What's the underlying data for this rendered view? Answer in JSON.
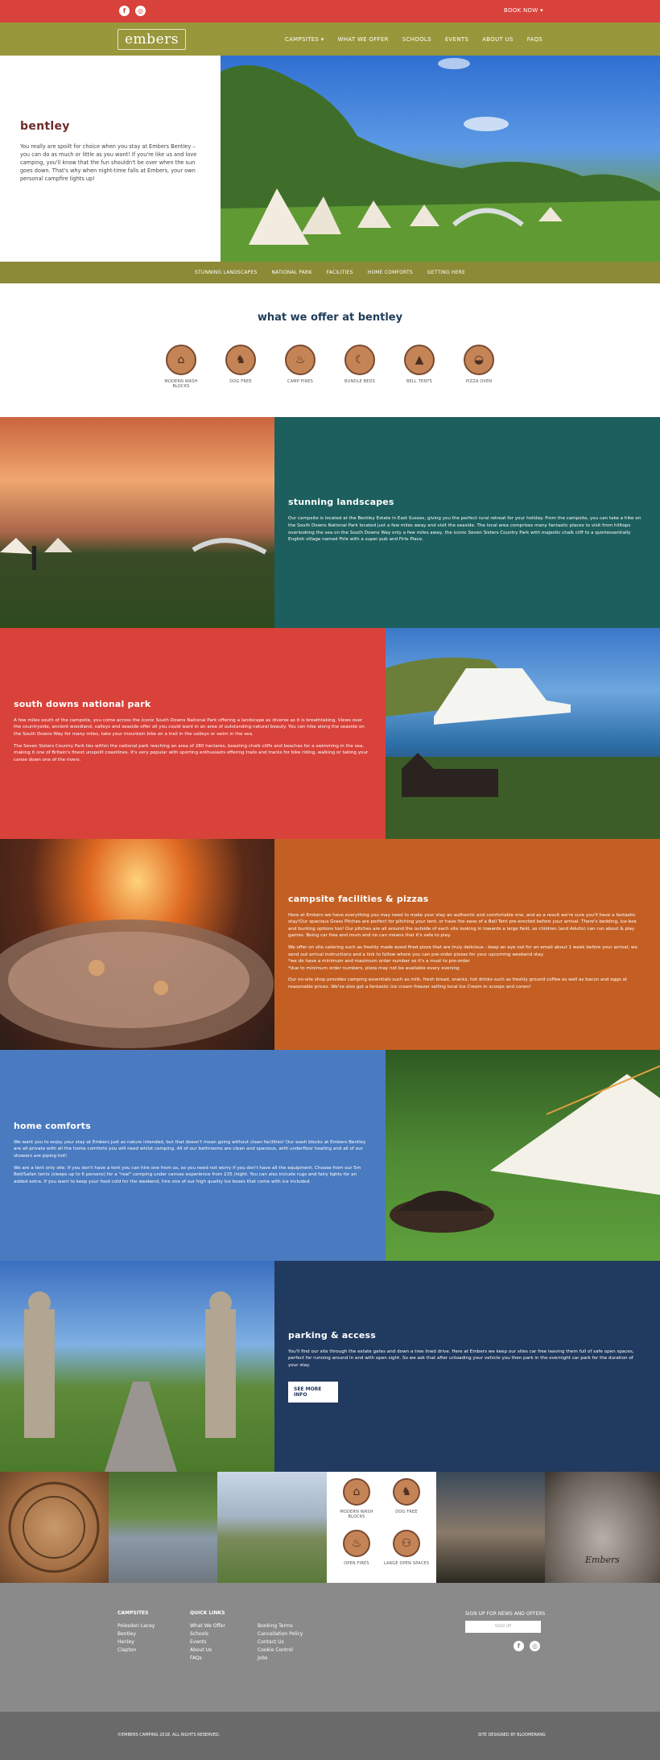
{
  "topbar": {
    "book_now": "BOOK NOW",
    "social": [
      "f",
      "◎"
    ]
  },
  "nav": {
    "logo": "embers",
    "links": [
      "CAMPSITES",
      "WHAT WE OFFER",
      "SCHOOLS",
      "EVENTS",
      "ABOUT US",
      "FAQS"
    ]
  },
  "hero": {
    "title": "bentley",
    "body": "You really are spoilt for choice when you stay at Embers Bentley – you can do as much or little as you want! If you're like us and love camping, you'll know that the fun shouldn't be over when the sun goes down. That's why when night-time falls at Embers, your own personal campfire lights up!"
  },
  "subnav": [
    "STUNNING LANDSCAPES",
    "NATIONAL PARK",
    "FACILITIES",
    "HOME COMFORTS",
    "GETTING HERE"
  ],
  "offer": {
    "title": "what we offer at bentley",
    "icons": [
      {
        "label": "MODERN WASH BLOCKS",
        "icon": "wash-icon"
      },
      {
        "label": "DOG FREE",
        "icon": "dog-icon"
      },
      {
        "label": "CAMP FIRES",
        "icon": "fire-icon"
      },
      {
        "label": "BUNDLE BEDS",
        "icon": "bed-icon"
      },
      {
        "label": "BELL TENTS",
        "icon": "tent-icon"
      },
      {
        "label": "PIZZA OVEN",
        "icon": "pizza-icon"
      }
    ]
  },
  "sections": [
    {
      "title": "stunning landscapes",
      "color": "#1d5f5e",
      "paras": [
        "Our campsite is located at the Bentley Estate in East Sussex, giving you the perfect rural retreat for your holiday.  From the campsite, you can take a hike on the South Downs National Park located just a few miles away and visit the seaside.  The local area comprises many fantastic places to visit from hilltops overlooking the sea on the South Downs Way only a few miles away, the iconic Seven Sisters Country Park with majestic chalk cliff to a quintessentially English village named Firle with a super pub and Firle Place."
      ]
    },
    {
      "title": "south downs national park",
      "color": "#d8423a",
      "paras": [
        "A few miles south of the campsite, you come across the iconic South Downs National Park offering a landscape as diverse as it is breathtaking.  Views over the countryside, ancient woodland, valleys and seaside offer all you could want in an area of outstanding natural beauty. You can hike along the seaside on the South Downs Way for many miles, take your mountain bike on a trail in the valleys or swim in the sea.",
        "The Seven Sisters Country Park lies within the national park reaching an area of 280 hectares, boasting chalk cliffs and beaches for a swimming in the sea, making it one of Britain's finest unspoilt coastlines.  It's very popular with sporting enthusiasts offering trails and tracks for bike riding, walking or taking your canoe down one of the rivers."
      ]
    },
    {
      "title": "campsite facilities & pizzas",
      "color": "#c45f23",
      "paras": [
        "Here at Embers we have everything you may need to make your stay an authentic and comfortable one, and as a result we're sure you'll have a fantastic stay!Our spacious Grass Pitches are perfect for pitching your tent, or have the ease of a Bell Tent pre-erected before your arrival. There's bedding, ice-box and bunting options too! Our pitches are all around the outside of each site looking in towards a large field, so children (and Adults) can run about & play games. Being car free and mum and no can means that it's safe to play.",
        "We offer on site catering such as freshly made wood fired pizza that are truly delicious - keep an eye out for an email about 1 week before your arrival; we send out arrival instructions and a link to follow where you can pre-order pizzas for your upcoming weekend stay.\n*we do have a minimum and maximum order number so it's a must to pre-order\n*due to minimum order numbers, pizza may not be available every evening",
        "Our on-site shop provides camping essentials such as milk, fresh bread, snacks, hot drinks such as freshly ground coffee as well as bacon and eggs at reasonable prices. We've also got a fantastic ice cream freezer selling local Ice Cream in scoops and cones!"
      ]
    },
    {
      "title": "home comforts",
      "color": "#4a7bc0",
      "paras": [
        "We want you to enjoy your stay at Embers just as nature intended, but that doesn't mean going without clean facilities! Our wash blocks at Embers Bentley are all-private with all the home comforts you will need whilst camping. All of our bathrooms are clean and spacious, with underfloor heating and all of our showers are piping hot!",
        "We are a tent only site. If you don't have a tent you can hire one from us, so you need not worry if you don't have all the equipment. Choose from our 5m Bell/Safari tents (sleeps up to 6 persons) for a \"real\" camping under canvas experience from £35 /night. You can also include rugs and fairy lights for an added extra. If you want to keep your food cold for the weekend, hire one of our high quality ice boxes that come with ice included."
      ]
    },
    {
      "title": "parking & access",
      "color": "#213a5f",
      "paras": [
        "You'll find our site through the estate gates and down a tree lined drive. Here at Embers we keep our sites car free leaving them full of safe open spaces, perfect for running around in and with open sight. So we ask that after unloading your vehicle you then park in the overnight car park for the duration of your stay."
      ],
      "button": "SEE MORE INFO"
    }
  ],
  "gallery_icons": [
    {
      "label": "MODERN WASH BLOCKS",
      "icon": "wash-icon"
    },
    {
      "label": "DOG FREE",
      "icon": "dog-icon"
    },
    {
      "label": "OPEN FIRES",
      "icon": "fire-icon"
    },
    {
      "label": "LARGE OPEN SPACES",
      "icon": "spaces-icon"
    }
  ],
  "gallery_sign": "Embers",
  "footer": {
    "campsites_title": "CAMPSITES",
    "campsites": [
      "Polesden Lacey",
      "Bentley",
      "Henley",
      "Clapton"
    ],
    "quick_title": "QUICK LINKS",
    "quick1": [
      "What We Offer",
      "Schools",
      "Events",
      "About Us",
      "FAQs"
    ],
    "quick2": [
      "Booking Terms",
      "Cancellation Policy",
      "Contact Us",
      "Cookie Control",
      "Jobs"
    ],
    "signup_title": "SIGN UP FOR NEWS AND OFFERS",
    "signup_btn": "SIGN UP",
    "copyright": "©EMBERS CAMPING 2018. ALL RIGHTS RESERVED.",
    "credit": "SITE DESIGNED BY BLOOMERANG"
  }
}
